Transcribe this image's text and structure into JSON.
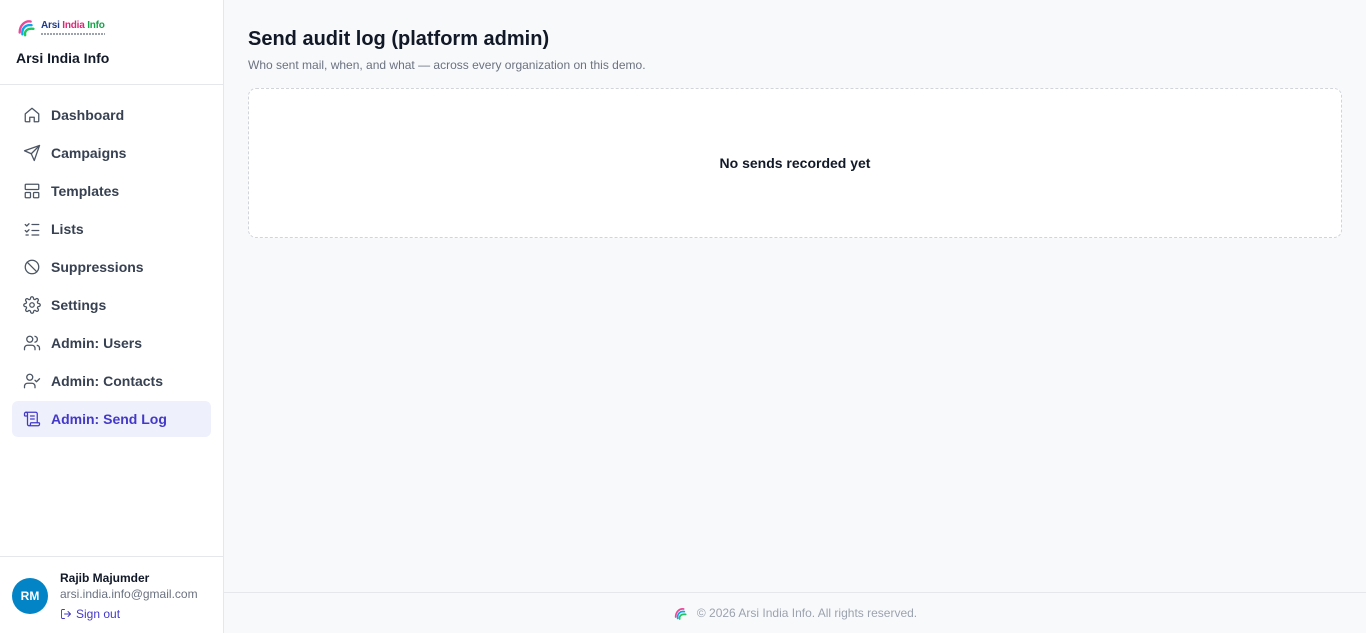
{
  "brand": {
    "logo_word_1": "Arsi",
    "logo_word_2": "India",
    "logo_word_3": "Info",
    "name": "Arsi India Info"
  },
  "sidebar": {
    "items": [
      {
        "label": "Dashboard",
        "icon": "home-icon"
      },
      {
        "label": "Campaigns",
        "icon": "send-icon"
      },
      {
        "label": "Templates",
        "icon": "layout-icon"
      },
      {
        "label": "Lists",
        "icon": "list-checks-icon"
      },
      {
        "label": "Suppressions",
        "icon": "ban-icon"
      },
      {
        "label": "Settings",
        "icon": "gear-icon"
      },
      {
        "label": "Admin: Users",
        "icon": "users-icon"
      },
      {
        "label": "Admin: Contacts",
        "icon": "user-check-icon"
      },
      {
        "label": "Admin: Send Log",
        "icon": "scroll-icon",
        "active": true
      }
    ]
  },
  "user": {
    "initials": "RM",
    "name": "Rajib Majumder",
    "email": "arsi.india.info@gmail.com",
    "signout_label": "Sign out"
  },
  "main": {
    "title": "Send audit log (platform admin)",
    "subtitle": "Who sent mail, when, and what — across every organization on this demo.",
    "empty_text": "No sends recorded yet"
  },
  "footer": {
    "text": "© 2026 Arsi India Info. All rights reserved."
  },
  "colors": {
    "accent": "#4338ca",
    "active_bg": "#eef0fb",
    "avatar": "#0284c7"
  }
}
